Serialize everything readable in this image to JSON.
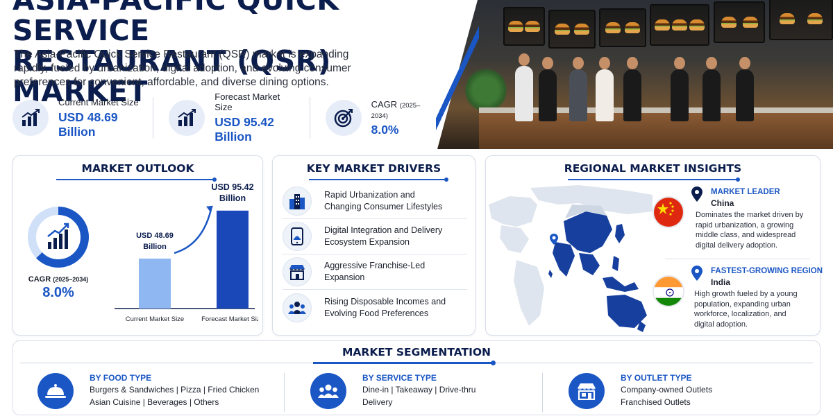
{
  "header": {
    "title_line1": "ASIA-PACIFIC QUICK SERVICE",
    "title_line2": "RESTAURANT (QSR) MARKET",
    "subtitle": "The Asia-Pacific Quick Service Restaurant (QSR) market is expanding rapidly, fueled by urbanization, digital adoption, and evolving consumer preferences for convenient, affordable, and diverse dining options."
  },
  "stats": [
    {
      "label": "Current Market Size",
      "value": "USD 48.69 Billion",
      "icon": "bar-chart-growth-icon"
    },
    {
      "label": "Forecast Market Size",
      "value": "USD 95.42 Billion",
      "icon": "bar-chart-growth-icon"
    },
    {
      "label": "CAGR",
      "label_note": "(2025–2034)",
      "value": "8.0%",
      "icon": "target-icon"
    }
  ],
  "outlook": {
    "title": "MARKET OUTLOOK",
    "cagr_label": "CAGR",
    "cagr_note": "(2025–2034)",
    "cagr_value": "8.0%"
  },
  "chart_data": {
    "type": "bar",
    "categories": [
      "Current Market Size",
      "Forecast Market Size"
    ],
    "values": [
      48.69,
      95.42
    ],
    "value_labels": [
      "USD 48.69 Billion",
      "USD 95.42 Billion"
    ],
    "bar_colors": [
      "#8fb7f2",
      "#1a48b8"
    ],
    "title": "",
    "xlabel": "",
    "ylabel": "",
    "ylim": [
      0,
      100
    ],
    "grid": false
  },
  "drivers": {
    "title": "KEY MARKET DRIVERS",
    "items": [
      {
        "line1": "Rapid Urbanization and",
        "line2": "Changing Consumer Lifestyles",
        "icon": "city-buildings-icon"
      },
      {
        "line1": "Digital Integration and Delivery",
        "line2": "Ecosystem Expansion",
        "icon": "mobile-delivery-icon"
      },
      {
        "line1": "Aggressive Franchise-Led",
        "line2": "Expansion",
        "icon": "storefront-icon"
      },
      {
        "line1": "Rising Disposable Incomes and",
        "line2": "Evolving Food Preferences",
        "icon": "people-group-icon"
      }
    ]
  },
  "regional": {
    "title": "REGIONAL MARKET INSIGHTS",
    "leader": {
      "kicker": "MARKET LEADER",
      "country": "China",
      "desc": [
        "Dominates the market driven by",
        "rapid urbanization, a growing",
        "middle class, and widespread",
        "digital delivery adoption."
      ],
      "flag": "china-flag-icon"
    },
    "fastest": {
      "kicker": "FASTEST-GROWING REGION",
      "country": "India",
      "desc": [
        "High growth fueled by a young",
        "population, expanding urban",
        "workforce, localization, and",
        "digital adoption."
      ],
      "flag": "india-flag-icon"
    },
    "colors": {
      "highlight": "#173f9e",
      "land": "#dfe5ee",
      "pin": "#1a56c4"
    }
  },
  "segmentation": {
    "title": "MARKET SEGMENTATION",
    "groups": [
      {
        "head": "BY FOOD TYPE",
        "line1": "Burgers & Sandwiches  |  Pizza  |  Fried Chicken",
        "line2": "Asian Cuisine  |  Beverages  |  Others",
        "icon": "cloche-icon"
      },
      {
        "head": "BY SERVICE TYPE",
        "line1": "Dine-in  |  Takeaway  |  Drive-thru",
        "line2": "Delivery",
        "icon": "people-group-icon"
      },
      {
        "head": "BY OUTLET TYPE",
        "line1": "Company-owned Outlets",
        "line2": "Franchised Outlets",
        "icon": "storefront-icon"
      }
    ]
  },
  "colors": {
    "navy": "#0b1d4d",
    "accent": "#1a56c4",
    "light_bar": "#8fb7f2",
    "dark_bar": "#1a48b8"
  }
}
